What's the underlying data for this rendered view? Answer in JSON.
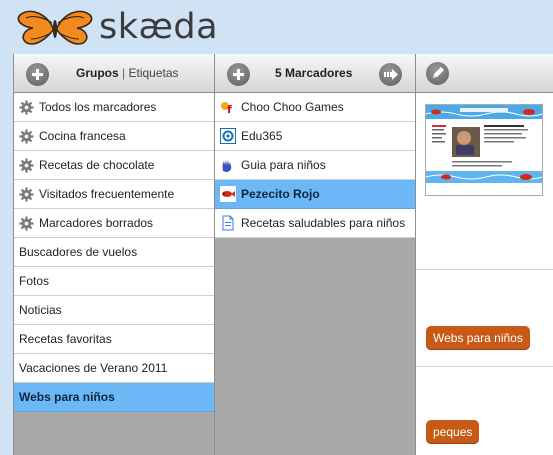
{
  "app": {
    "logo_text": "skæda"
  },
  "groups_column": {
    "title": "Grupos",
    "separator": "|",
    "alt_tab": "Etiquetas",
    "items": [
      {
        "label": "Todos los marcadores",
        "icon": "gear-icon"
      },
      {
        "label": "Cocina francesa",
        "icon": "gear-icon"
      },
      {
        "label": "Recetas de chocolate",
        "icon": "gear-icon"
      },
      {
        "label": "Visitados frecuentemente",
        "icon": "gear-icon"
      },
      {
        "label": "Marcadores borrados",
        "icon": "gear-icon"
      },
      {
        "label": "Buscadores de vuelos"
      },
      {
        "label": "Fotos"
      },
      {
        "label": "Noticias"
      },
      {
        "label": "Recetas favoritas"
      },
      {
        "label": "Vacaciones de Verano 2011"
      },
      {
        "label": "Webs para niños",
        "selected": true
      }
    ]
  },
  "bookmarks_column": {
    "title": "5 Marcadores",
    "items": [
      {
        "label": "Choo Choo Games",
        "icon": "choochoo-favicon"
      },
      {
        "label": "Edu365",
        "icon": "edu365-favicon"
      },
      {
        "label": "Guia para niños",
        "icon": "hands-favicon"
      },
      {
        "label": "Pezecito Rojo",
        "icon": "fish-favicon",
        "selected": true
      },
      {
        "label": "Recetas saludables para niños",
        "icon": "document-icon"
      }
    ]
  },
  "detail_column": {
    "tags": [
      "Webs para niños",
      "peques"
    ]
  },
  "colors": {
    "page_bg": "#cfe3f4",
    "selected_row": "#6cb8f7",
    "tag_pill": "#c65a16",
    "column_bg": "#a8a8a8"
  }
}
